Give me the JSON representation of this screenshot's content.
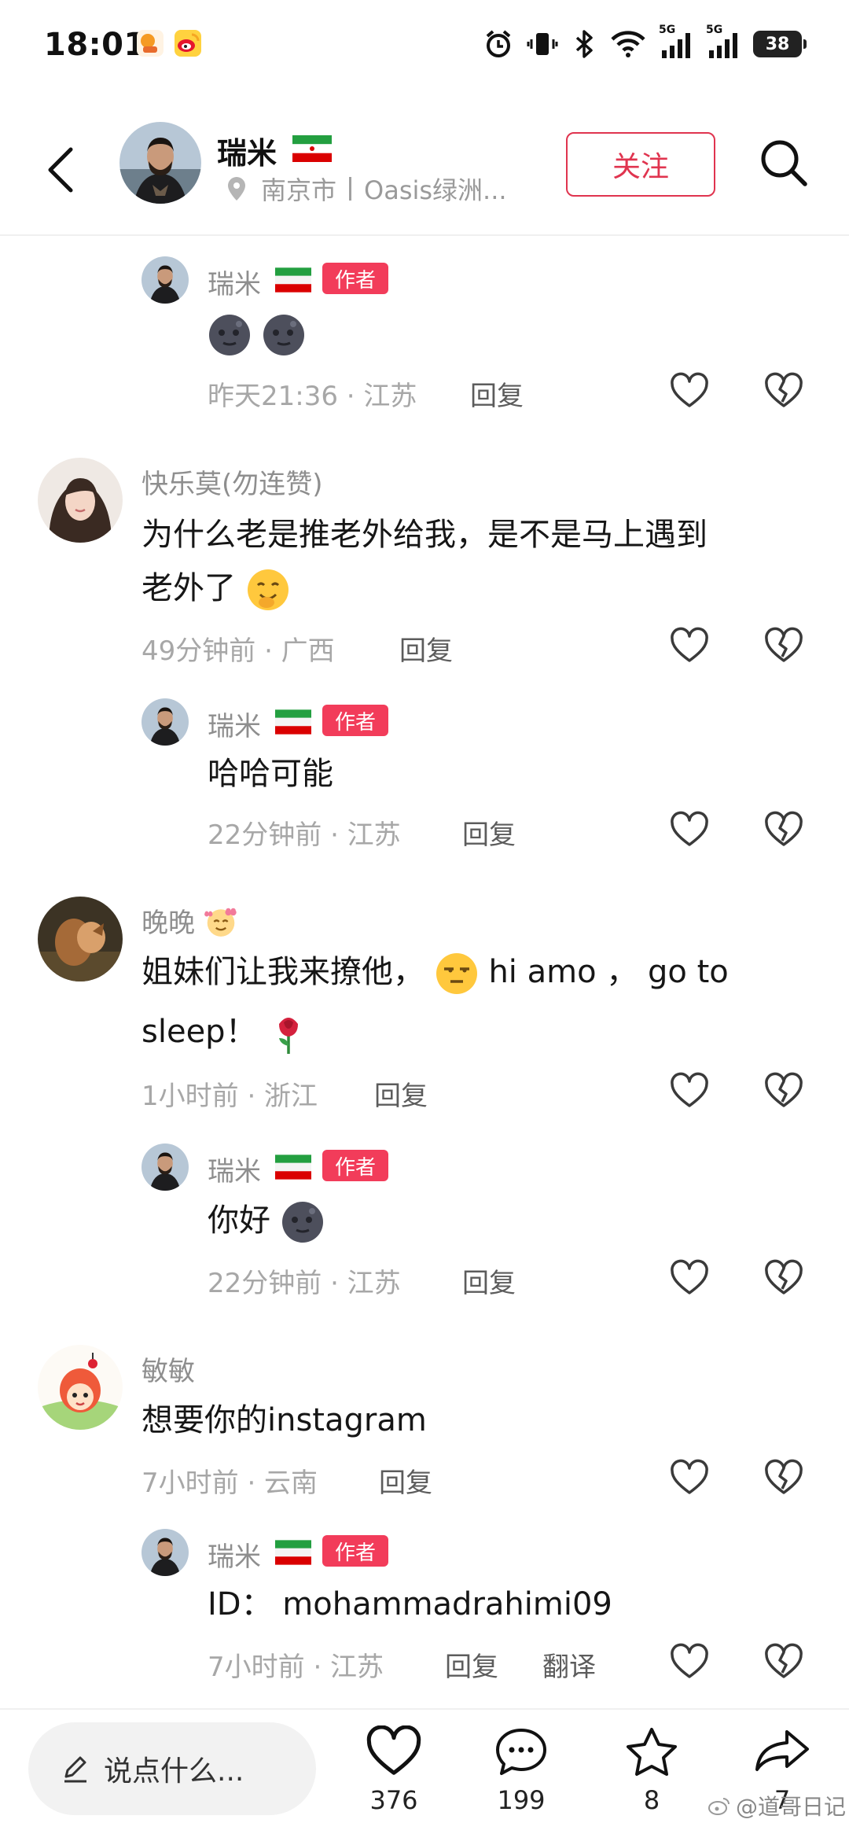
{
  "status_bar": {
    "time": "18:01",
    "signal_a": "5G",
    "signal_b": "5G",
    "battery": "38"
  },
  "header": {
    "name": "瑞米",
    "city": "南京市",
    "place": "Oasis绿洲...",
    "follow_label": "关注"
  },
  "labels": {
    "author_badge": "作者",
    "reply": "回复",
    "translate": "翻译"
  },
  "comments": [
    {
      "user": "瑞米",
      "text": "",
      "time": "昨天21:36 · 江苏"
    },
    {
      "user": "快乐莫(勿连赞)",
      "text_line1": "为什么老是推老外给我，是不是马上遇到",
      "text_line2": "老外了",
      "time": "49分钟前 · 广西"
    },
    {
      "user": "瑞米",
      "text": "哈哈可能",
      "time": "22分钟前 · 江苏"
    },
    {
      "user": "晚晚",
      "text_line1": "姐妹们让我来撩他，",
      "text_line1b": "hi   amo ， go to",
      "text_line2": "sleep！",
      "time": "1小时前 · 浙江"
    },
    {
      "user": "瑞米",
      "text": "你好",
      "time": "22分钟前 · 江苏"
    },
    {
      "user": "敏敏",
      "text": "想要你的instagram",
      "time": "7小时前 · 云南"
    },
    {
      "user": "瑞米",
      "text": "ID：  mohammadrahimi09",
      "time": "7小时前 · 江苏"
    }
  ],
  "bottom_bar": {
    "input_placeholder": "说点什么...",
    "likes": "376",
    "comments": "199",
    "stars": "8",
    "shares": "7"
  },
  "watermark": "@道哥日记",
  "colors": {
    "accent": "#f23c5a",
    "follow": "#e0344f",
    "meta": "#a7a7a7"
  }
}
